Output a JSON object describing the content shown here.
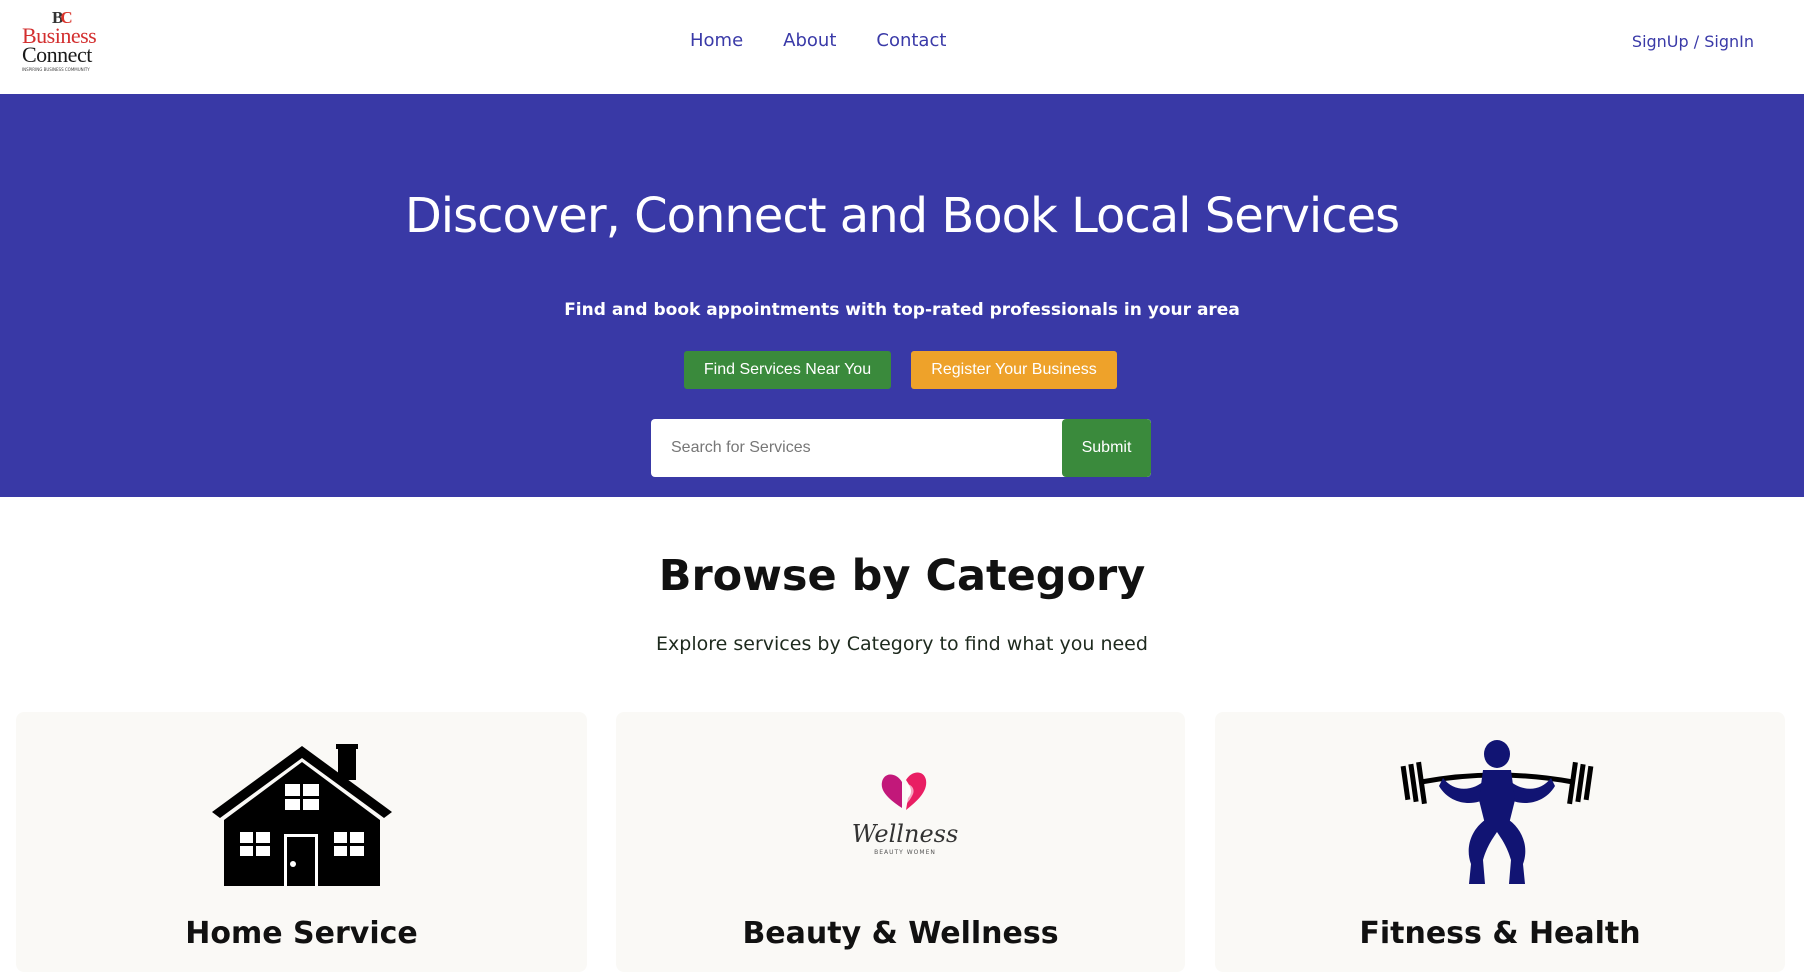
{
  "header": {
    "logo": {
      "mark_b": "B",
      "mark_c": "C",
      "line1": "Business",
      "line2": "Connect",
      "tagline": "INSPIRING BUSINESS COMMUNITY"
    },
    "nav": [
      {
        "label": "Home"
      },
      {
        "label": "About"
      },
      {
        "label": "Contact"
      }
    ],
    "signin_label": "SignUp / SignIn"
  },
  "hero": {
    "title": "Discover, Connect and Book Local Services",
    "subtitle": "Find and book appointments with top-rated professionals in your area",
    "find_button": "Find Services Near You",
    "register_button": "Register Your Business",
    "search": {
      "placeholder": "Search for Services",
      "value": "",
      "submit_label": "Submit"
    }
  },
  "categories": {
    "title": "Browse by Category",
    "subtitle": "Explore services by Category to find what you need",
    "items": [
      {
        "label": "Home Service",
        "icon": "house-icon"
      },
      {
        "label": "Beauty & Wellness",
        "icon": "wellness-logo-icon",
        "logo_text": "Wellness",
        "logo_subtext": "BEAUTY WOMEN"
      },
      {
        "label": "Fitness & Health",
        "icon": "weightlifter-icon"
      }
    ]
  },
  "colors": {
    "hero_bg": "#3939a6",
    "nav_link": "#3a3aa8",
    "primary_green": "#3a8a3c",
    "accent_orange": "#eea22a",
    "card_bg": "#faf9f6"
  }
}
